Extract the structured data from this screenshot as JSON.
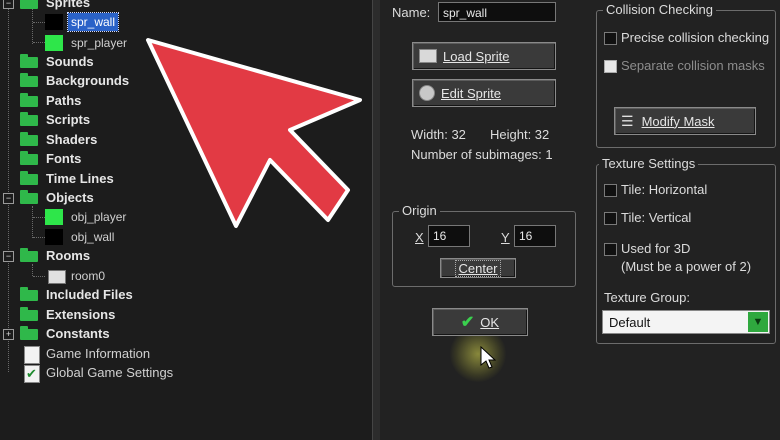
{
  "tree": {
    "sprites": "Sprites",
    "spr_wall": "spr_wall",
    "spr_player": "spr_player",
    "sounds": "Sounds",
    "backgrounds": "Backgrounds",
    "paths": "Paths",
    "scripts": "Scripts",
    "shaders": "Shaders",
    "fonts": "Fonts",
    "time_lines": "Time Lines",
    "objects": "Objects",
    "obj_player": "obj_player",
    "obj_wall": "obj_wall",
    "rooms": "Rooms",
    "room0": "room0",
    "included_files": "Included Files",
    "extensions": "Extensions",
    "constants": "Constants",
    "game_information": "Game Information",
    "global_game_settings": "Global Game Settings"
  },
  "sprite": {
    "name_label": "Name:",
    "name_value": "spr_wall",
    "load_sprite": "Load Sprite",
    "edit_sprite": "Edit Sprite",
    "width_text": "Width: 32",
    "height_text": "Height: 32",
    "subimages_text": "Number of subimages: 1"
  },
  "origin": {
    "title": "Origin",
    "x_label": "X",
    "x_value": "16",
    "y_label": "Y",
    "y_value": "16",
    "center": "Center"
  },
  "ok": "OK",
  "collision": {
    "title": "Collision Checking",
    "precise": "Precise collision checking",
    "separate": "Separate collision masks",
    "modify_mask": "Modify Mask"
  },
  "texture": {
    "title": "Texture Settings",
    "tile_h": "Tile: Horizontal",
    "tile_v": "Tile: Vertical",
    "used_3d": "Used for 3D",
    "power_note": "(Must be a power of 2)",
    "group_label": "Texture Group:",
    "group_value": "Default"
  },
  "colors": {
    "folder": "#2fb84a",
    "selection": "#2a62c8",
    "arrow": "#e23a44"
  },
  "icons": [
    "folder-icon",
    "sprite-thumb-icon",
    "load-icon",
    "edit-icon",
    "mask-icon",
    "checkmark-icon",
    "dropdown-arrow-icon",
    "room-icon",
    "document-icon",
    "pointer-arrow"
  ]
}
